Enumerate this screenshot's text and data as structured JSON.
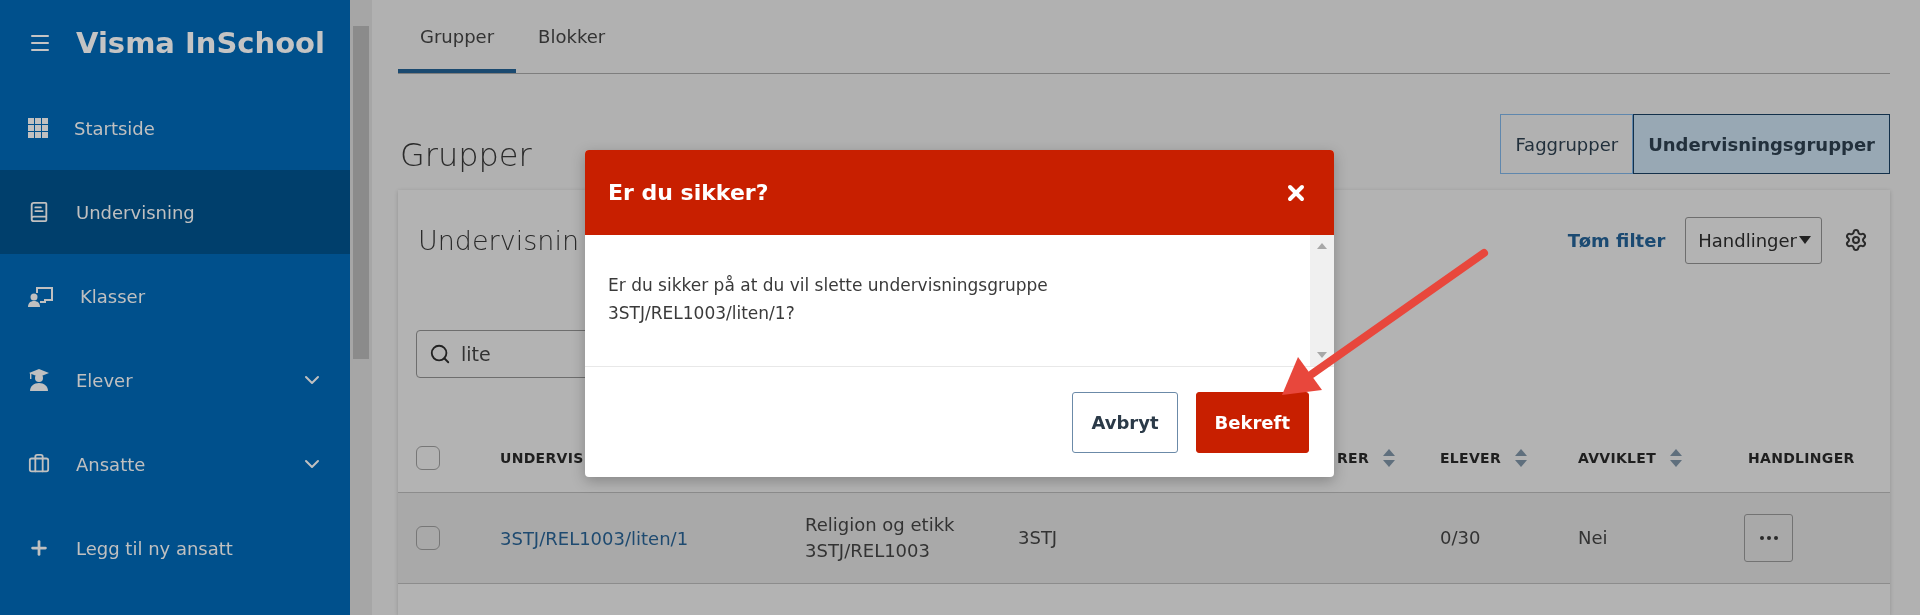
{
  "sidebar": {
    "title": "Visma InSchool",
    "items": [
      {
        "label": "Startside",
        "selected": false,
        "expandable": false
      },
      {
        "label": "Undervisning",
        "selected": true,
        "expandable": false
      },
      {
        "label": "Klasser",
        "selected": false,
        "expandable": false
      },
      {
        "label": "Elever",
        "selected": false,
        "expandable": true
      },
      {
        "label": "Ansatte",
        "selected": false,
        "expandable": true
      },
      {
        "label": "Legg til ny ansatt",
        "selected": false,
        "expandable": false
      }
    ]
  },
  "tabs": [
    {
      "label": "Grupper",
      "selected": true
    },
    {
      "label": "Blokker",
      "selected": false
    }
  ],
  "heading": "Grupper",
  "view_toggle": [
    {
      "label": "Faggrupper",
      "selected": false
    },
    {
      "label": "Undervisningsgrupper",
      "selected": true
    }
  ],
  "card": {
    "title": "Undervisnin",
    "clear_filter": "Tøm filter",
    "actions_button": "Handlinger",
    "search": {
      "value": "lite"
    },
    "table": {
      "select_all_checked": false,
      "columns": [
        {
          "label": "UNDERVIS",
          "sortable": false
        },
        {
          "label": "RER",
          "sortable": true
        },
        {
          "label": "ELEVER",
          "sortable": true
        },
        {
          "label": "AVVIKLET",
          "sortable": true
        },
        {
          "label": "HANDLINGER",
          "sortable": false
        }
      ],
      "rows": [
        {
          "checked": false,
          "name": "3STJ/REL1003/liten/1",
          "subject": "Religion og etikk\n3STJ/REL1003",
          "column_3": "3STJ",
          "students": "0/30",
          "discontinued": "Nei"
        }
      ]
    }
  },
  "dialog": {
    "title": "Er du sikker?",
    "message": "Er du sikker på at du vil slette undervisningsgruppe 3STJ/REL1003/liten/1?",
    "buttons": [
      {
        "label": "Avbryt",
        "kind": "secondary"
      },
      {
        "label": "Bekreft",
        "kind": "primary"
      }
    ]
  }
}
